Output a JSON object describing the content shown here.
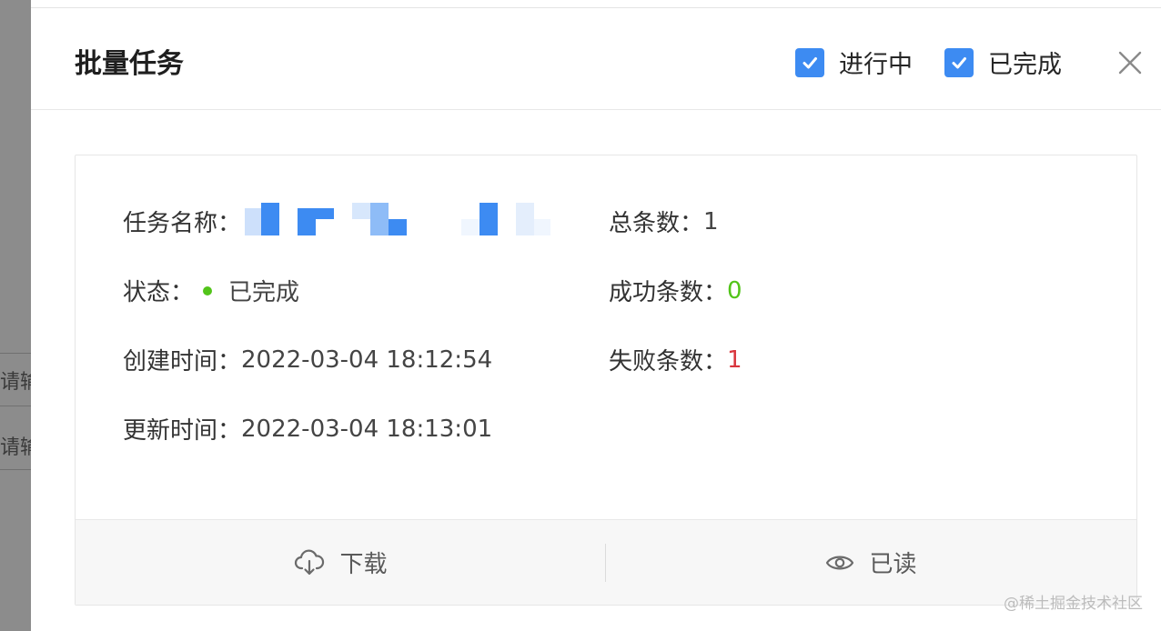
{
  "background": {
    "partial_texts": [
      "请输",
      "请输"
    ]
  },
  "header": {
    "title": "批量任务",
    "filters": [
      {
        "label": "进行中",
        "checked": true
      },
      {
        "label": "已完成",
        "checked": true
      }
    ],
    "close_icon": "close-icon"
  },
  "task": {
    "name_label": "任务名称：",
    "status_label": "状态：",
    "status_value": "已完成",
    "created_label": "创建时间：",
    "created_value": "2022-03-04 18:12:54",
    "updated_label": "更新时间：",
    "updated_value": "2022-03-04 18:13:01",
    "total_label": "总条数：",
    "total_value": "1",
    "success_label": "成功条数：",
    "success_value": "0",
    "failed_label": "失败条数：",
    "failed_value": "1"
  },
  "actions": {
    "download_label": "下载",
    "download_icon": "cloud-download-icon",
    "read_label": "已读",
    "read_icon": "eye-icon"
  },
  "watermark": "@稀土掘金技术社区",
  "colors": {
    "accent": "#3d8bf2",
    "success": "#52c41a",
    "error": "#d9363e"
  }
}
